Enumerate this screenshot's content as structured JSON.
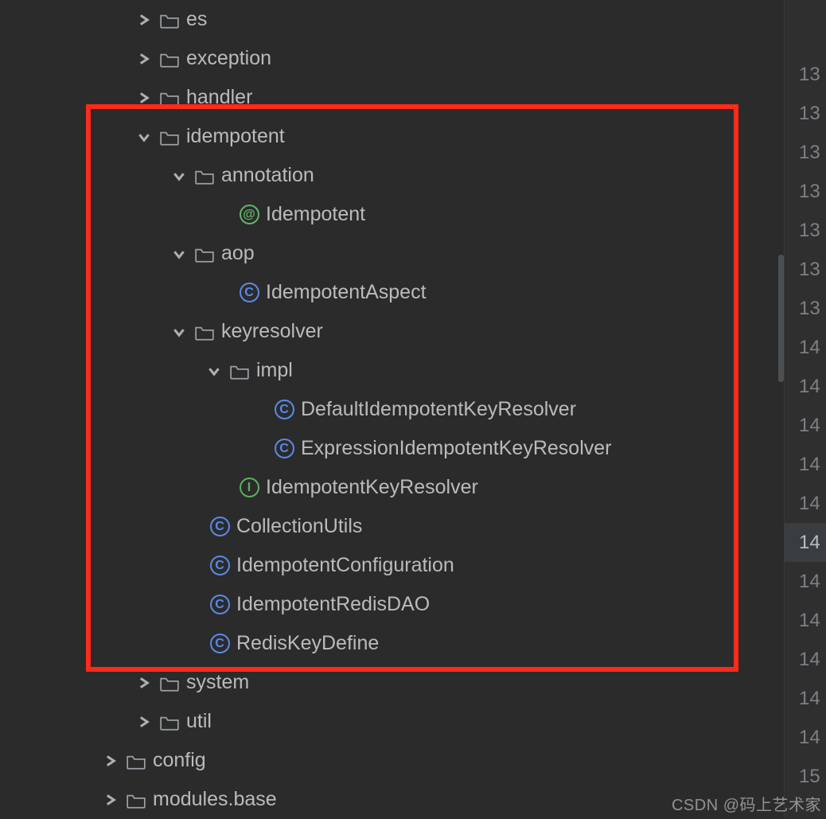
{
  "icons": {
    "class_letter": "C",
    "annotation_letter": "@",
    "interface_letter": "I"
  },
  "tree": {
    "es": {
      "label": "es"
    },
    "exception": {
      "label": "exception"
    },
    "handler": {
      "label": "handler"
    },
    "idempotent": {
      "label": "idempotent",
      "annotation": {
        "label": "annotation",
        "Idempotent": {
          "label": "Idempotent"
        }
      },
      "aop": {
        "label": "aop",
        "IdempotentAspect": {
          "label": "IdempotentAspect"
        }
      },
      "keyresolver": {
        "label": "keyresolver",
        "impl": {
          "label": "impl",
          "DefaultIdempotentKeyResolver": {
            "label": "DefaultIdempotentKeyResolver"
          },
          "ExpressionIdempotentKeyResolver": {
            "label": "ExpressionIdempotentKeyResolver"
          }
        },
        "IdempotentKeyResolver": {
          "label": "IdempotentKeyResolver"
        }
      },
      "CollectionUtils": {
        "label": "CollectionUtils"
      },
      "IdempotentConfiguration": {
        "label": "IdempotentConfiguration"
      },
      "IdempotentRedisDAO": {
        "label": "IdempotentRedisDAO"
      },
      "RedisKeyDefine": {
        "label": "RedisKeyDefine"
      }
    },
    "system": {
      "label": "system"
    },
    "util": {
      "label": "util"
    },
    "config": {
      "label": "config"
    },
    "modules_base": {
      "label": "modules.base"
    }
  },
  "gutter": {
    "lines": [
      "",
      "13",
      "13",
      "13",
      "13",
      "13",
      "13",
      "13",
      "14",
      "14",
      "14",
      "14",
      "14",
      "14",
      "14",
      "14",
      "14",
      "14",
      "14",
      "15"
    ],
    "highlight_index": 13
  },
  "watermark": "CSDN @码上艺术家"
}
